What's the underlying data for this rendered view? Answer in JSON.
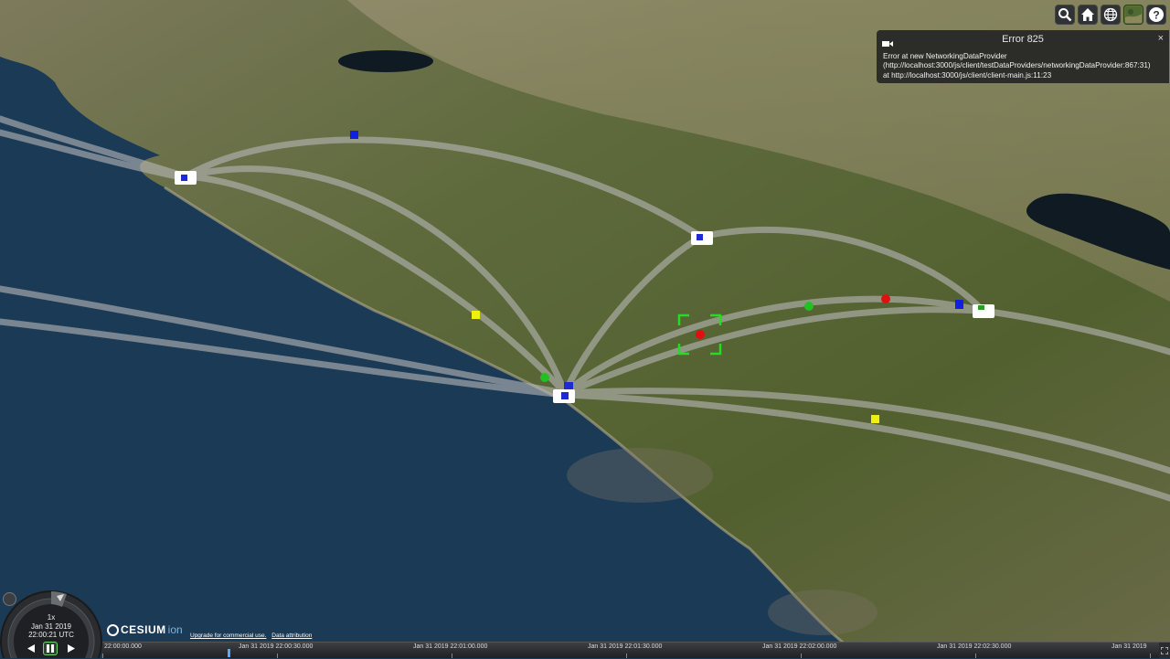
{
  "toolbar": {
    "search": "search-icon",
    "home": "home-icon",
    "scene_mode": "globe-icon",
    "base_layer": "imagery-layer-icon",
    "help": "help-icon"
  },
  "error": {
    "title": "Error 825",
    "close": "×",
    "line1": "Error at new NetworkingDataProvider",
    "line2": "(http://localhost:3000/js/client/testDataProviders/networkingDataProvider:867:31)",
    "line3": "at http://localhost:3000/js/client/client-main.js:11:23"
  },
  "animation": {
    "speed": "1x",
    "date": "Jan 31 2019",
    "time": "22:00:21 UTC"
  },
  "credits": {
    "brand": "CESIUM",
    "brand_suffix": "ion",
    "upgrade": "Upgrade for commercial use.",
    "attribution": "Data attribution"
  },
  "timeline": {
    "labels": [
      "22:00:00.000",
      "Jan 31 2019 22:00:30.000",
      "Jan 31 2019 22:01:00.000",
      "Jan 31 2019 22:01:30.000",
      "Jan 31 2019 22:02:00.000",
      "Jan 31 2019 22:02:30.000",
      "Jan 31 2019"
    ]
  },
  "colors": {
    "ocean": "#1b3a55",
    "land": "#5f6a3b",
    "marker_blue": "#1020e0",
    "marker_red": "#e01010",
    "marker_green": "#22c022",
    "marker_yellow": "#f0f010",
    "selection": "#22dd22",
    "link": "#b8b8b8"
  }
}
